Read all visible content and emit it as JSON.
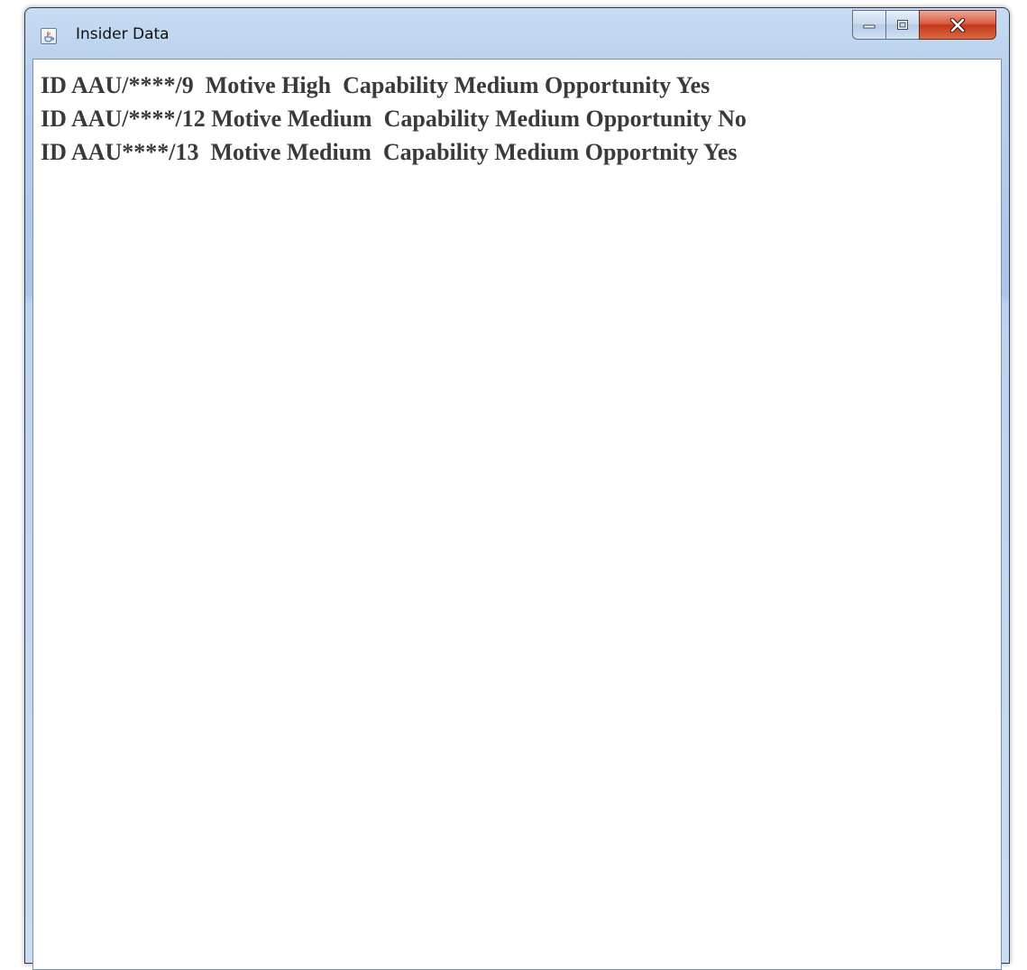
{
  "window": {
    "title": "Insider Data",
    "icon": "java-cup-icon"
  },
  "caption_buttons": {
    "minimize_icon": "minimize-icon",
    "maximize_icon": "maximize-icon",
    "close_label": "X"
  },
  "records": [
    "ID AAU/****/9  Motive High  Capability Medium Opportunity Yes",
    "ID AAU/****/12 Motive Medium  Capability Medium Opportunity No",
    "ID AAU****/13  Motive Medium  Capability Medium Opportnity Yes"
  ],
  "colors": {
    "titlebar": "#b9d1ee",
    "close_button": "#c2361a",
    "text": "#3a3a3a"
  }
}
